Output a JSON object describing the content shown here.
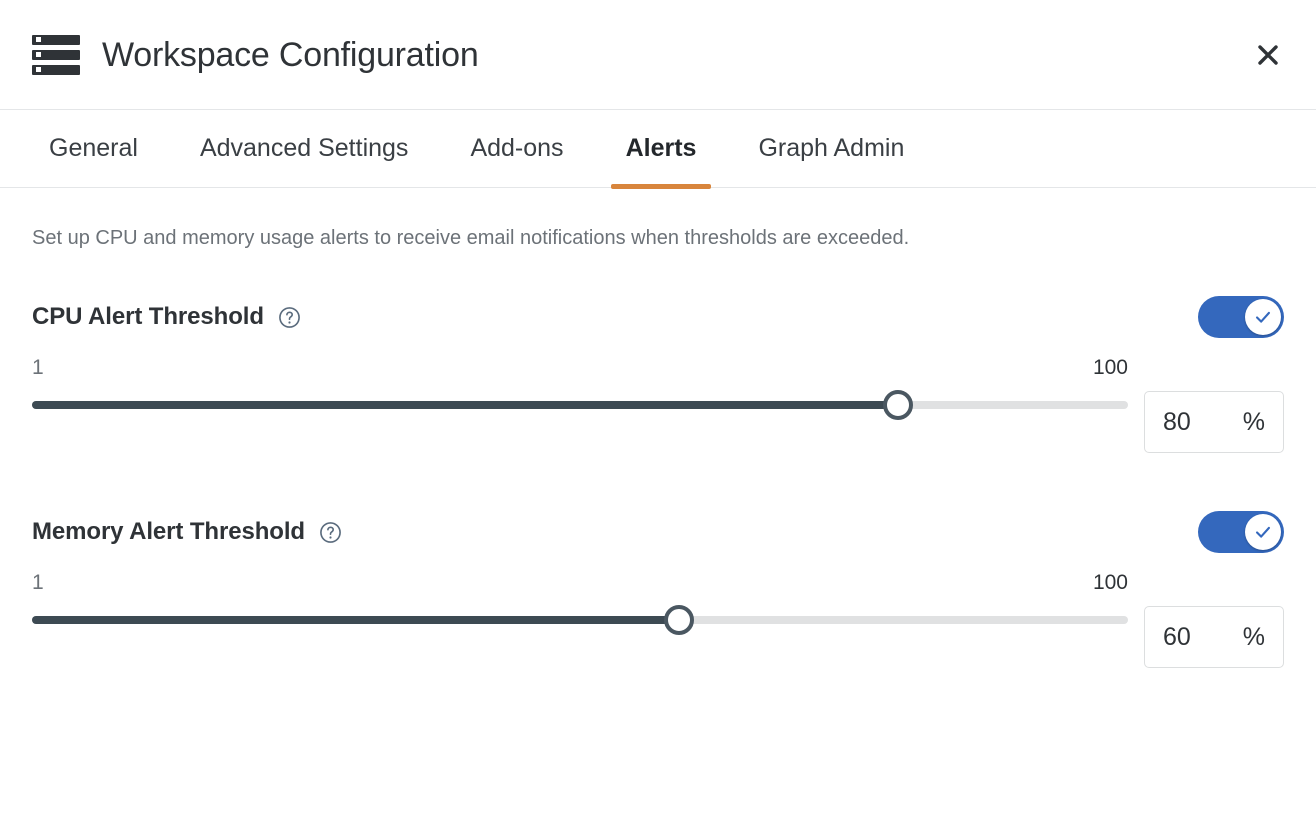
{
  "header": {
    "title": "Workspace Configuration",
    "icon": "server-stack-icon",
    "close_label": "×",
    "close_icon": "close-icon"
  },
  "tabs": [
    {
      "label": "General",
      "active": false
    },
    {
      "label": "Advanced Settings",
      "active": false
    },
    {
      "label": "Add-ons",
      "active": false
    },
    {
      "label": "Alerts",
      "active": true
    },
    {
      "label": "Graph Admin",
      "active": false
    }
  ],
  "main": {
    "description": "Set up CPU and memory usage alerts to receive email notifications when thresholds are exceeded.",
    "settings": [
      {
        "id": "cpu",
        "label": "CPU Alert Threshold",
        "help_icon": "help-circle-icon",
        "enabled": true,
        "toggle_icon": "check-icon",
        "range_min": "1",
        "range_max": "100",
        "value": "80",
        "unit": "%",
        "fill_percent": 79
      },
      {
        "id": "memory",
        "label": "Memory Alert Threshold",
        "help_icon": "help-circle-icon",
        "enabled": true,
        "toggle_icon": "check-icon",
        "range_min": "1",
        "range_max": "100",
        "value": "60",
        "unit": "%",
        "fill_percent": 59
      }
    ]
  },
  "colors": {
    "accent_orange": "#d8853c",
    "toggle_blue": "#3468bd",
    "slider_fill": "#3d4a53",
    "slider_rail": "#e0e1e2",
    "text_primary": "#2f3337",
    "text_muted": "#6c7278",
    "help_icon": "#5a6b7d"
  }
}
